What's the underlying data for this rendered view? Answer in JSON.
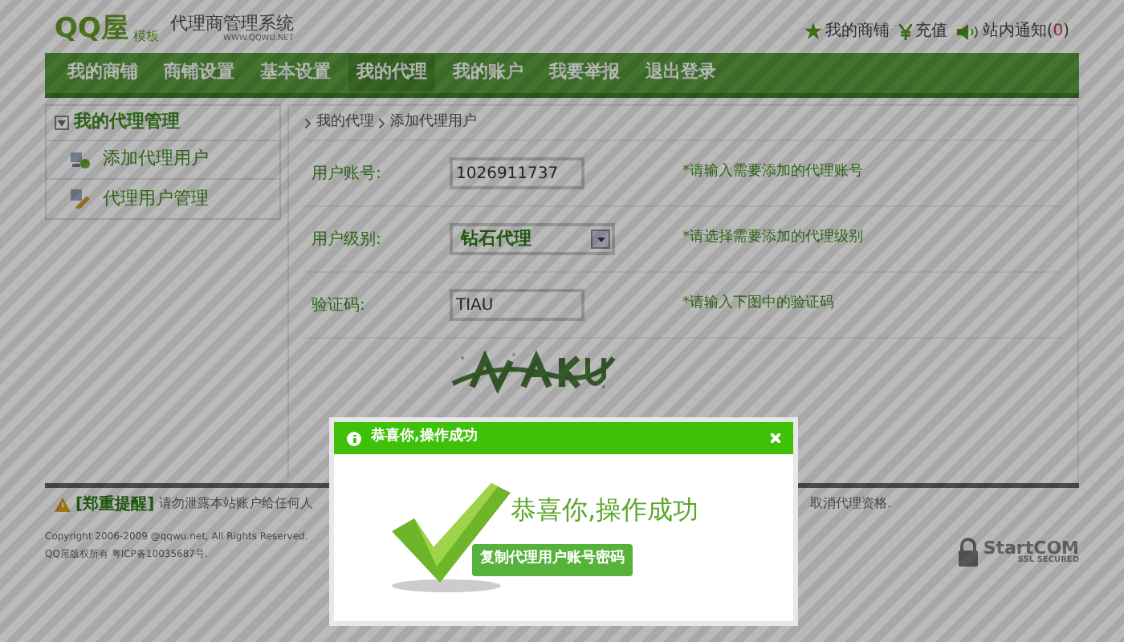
{
  "logo": {
    "brand": "QQ屋",
    "tag": "模板",
    "title": "代理商管理系统",
    "url": "WWW.QQWU.NET"
  },
  "top_links": [
    {
      "kind": "star",
      "label": "我的商铺"
    },
    {
      "kind": "yen",
      "label": "充值"
    },
    {
      "kind": "speaker",
      "label": "站内通知(",
      "count": "0",
      "tail": ")"
    }
  ],
  "nav": [
    {
      "label": "我的商铺",
      "selected": false
    },
    {
      "label": "商铺设置",
      "selected": false
    },
    {
      "label": "基本设置",
      "selected": false
    },
    {
      "label": "我的代理",
      "selected": true
    },
    {
      "label": "我的账户",
      "selected": false
    },
    {
      "label": "我要举报",
      "selected": false
    },
    {
      "label": "退出登录",
      "selected": false
    }
  ],
  "sidebar": {
    "title": "我的代理管理",
    "items": [
      {
        "kind": "add-user",
        "label": "添加代理用户"
      },
      {
        "kind": "manage",
        "label": "代理用户管理"
      }
    ]
  },
  "breadcrumb": [
    "我的代理",
    "添加代理用户"
  ],
  "form": [
    {
      "kind": "text",
      "label": "用户账号:",
      "value": "1026911737",
      "hint": "*请输入需要添加的代理账号"
    },
    {
      "kind": "select",
      "label": "用户级别:",
      "value": "钻石代理",
      "hint": "*请选择需要添加的代理级别"
    },
    {
      "kind": "text",
      "label": "验证码:",
      "value": "TIAU",
      "hint": "*请输入下图中的验证码"
    },
    {
      "kind": "captcha"
    }
  ],
  "footer": {
    "notice_title": "[郑重提醒]",
    "notice_left": "请勿泄露本站账户给任何人",
    "notice_right": "取消代理资格.",
    "copyright": [
      "Copyright 2006-2009 @qqwu.net, All Rights Reserved.",
      "QQ屋版权所有 粤ICP备10035687号."
    ],
    "ssl": {
      "brand": "StartCOM",
      "sub": "SSL SECURED"
    }
  },
  "dialog": {
    "title": "恭喜你,操作成功",
    "message": "恭喜你,操作成功",
    "button": "复制代理用户账号密码"
  }
}
